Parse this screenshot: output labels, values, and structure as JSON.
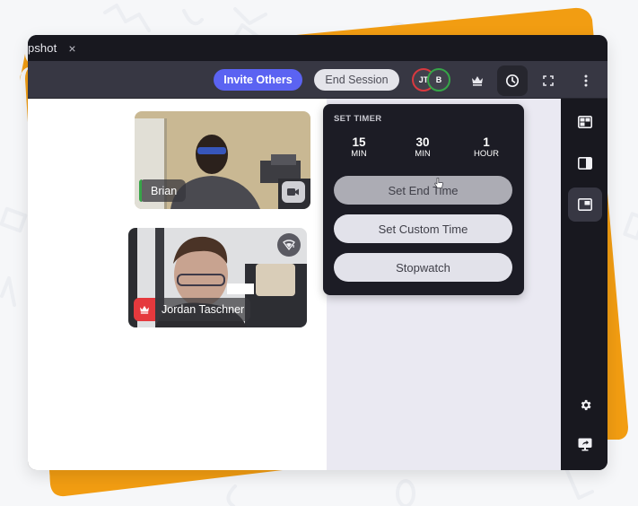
{
  "window": {
    "tab_title": "pshot",
    "tab_close": "×"
  },
  "toolbar": {
    "invite_label": "Invite Others",
    "end_session_label": "End Session",
    "participants": [
      {
        "initials": "JT",
        "ring_color": "#d8393f"
      },
      {
        "initials": "B",
        "ring_color": "#36a548"
      }
    ],
    "icons": [
      "crown-icon",
      "clock-icon",
      "fullscreen-icon",
      "more-vertical-icon"
    ],
    "active_icon": "clock-icon"
  },
  "timer_popover": {
    "title": "SET TIMER",
    "presets": [
      {
        "value": "15",
        "unit": "MIN"
      },
      {
        "value": "30",
        "unit": "MIN"
      },
      {
        "value": "1",
        "unit": "HOUR"
      }
    ],
    "buttons": [
      {
        "label": "Set End Time",
        "state": "hover"
      },
      {
        "label": "Set Custom Time",
        "state": "default"
      },
      {
        "label": "Stopwatch",
        "state": "default"
      }
    ]
  },
  "participants": [
    {
      "name": "Brian",
      "indicator_color": "#36a548",
      "action_icon": "video-camera-icon"
    },
    {
      "name": "Jordan Taschner",
      "badge_icon": "crown-icon",
      "badge_color": "#e5393d",
      "action_icon": "weak-signal-icon"
    }
  ],
  "sidebar": {
    "items": [
      "grid-layout-icon",
      "split-layout-icon",
      "picture-in-picture-icon"
    ],
    "active_item": "picture-in-picture-icon",
    "bottom_items": [
      "settings-icon",
      "screen-share-icon"
    ]
  },
  "colors": {
    "accent": "#5b63f2",
    "brand_orange": "#f29d12",
    "danger": "#e5393d",
    "success": "#36a548"
  }
}
